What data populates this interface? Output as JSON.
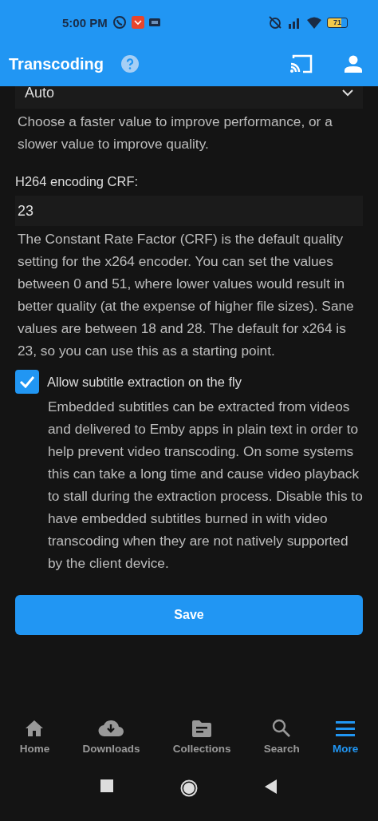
{
  "status_bar": {
    "time": "5:00 PM",
    "battery": "71"
  },
  "header": {
    "title": "Transcoding"
  },
  "quality_select": {
    "value": "Auto",
    "help": "Choose a faster value to improve performance, or a slower value to improve quality."
  },
  "crf_field": {
    "label": "H264 encoding CRF:",
    "value": "23",
    "help": "The Constant Rate Factor (CRF) is the default quality setting for the x264 encoder. You can set the values between 0 and 51, where lower values would result in better quality (at the expense of higher file sizes). Sane values are between 18 and 28. The default for x264 is 23, so you can use this as a starting point."
  },
  "subtitle_option": {
    "label": "Allow subtitle extraction on the fly",
    "checked": true,
    "help": "Embedded subtitles can be extracted from videos and delivered to Emby apps in plain text in order to help prevent video transcoding. On some systems this can take a long time and cause video playback to stall during the extraction process. Disable this to have embedded subtitles burned in with video transcoding when they are not natively supported by the client device."
  },
  "save_button": "Save",
  "nav": [
    {
      "label": "Home",
      "kind": "home",
      "selected": false
    },
    {
      "label": "Downloads",
      "kind": "downloads",
      "selected": false
    },
    {
      "label": "Collections",
      "kind": "collections",
      "selected": false
    },
    {
      "label": "Search",
      "kind": "search",
      "selected": false
    },
    {
      "label": "More",
      "kind": "more",
      "selected": true
    }
  ]
}
